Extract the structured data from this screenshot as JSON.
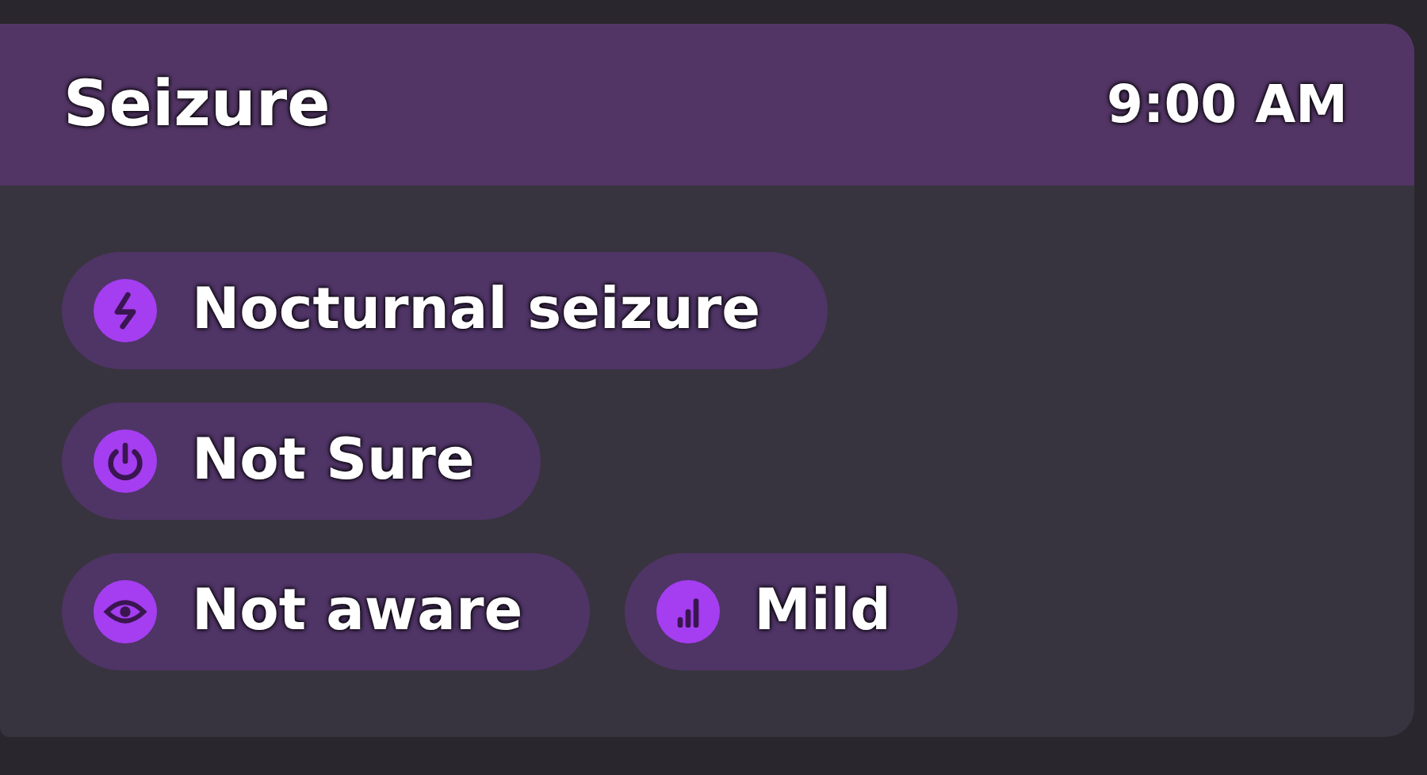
{
  "card": {
    "title": "Seizure",
    "time": "9:00 AM"
  },
  "chip_rows": [
    [
      {
        "kind": "bolt",
        "label": "Nocturnal seizure"
      }
    ],
    [
      {
        "kind": "power",
        "label": "Not Sure"
      }
    ],
    [
      {
        "kind": "eye",
        "label": "Not aware"
      },
      {
        "kind": "bars",
        "label": "Mild"
      }
    ]
  ]
}
